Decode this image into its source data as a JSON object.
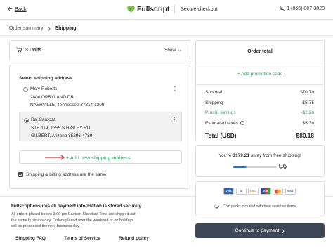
{
  "header": {
    "back_label": "Back",
    "brand_name": "Fullscript",
    "secure_label": "Secure checkout",
    "phone": "1 (866) 807-3828"
  },
  "breadcrumb": {
    "items": [
      "Order summary",
      "Shipping"
    ]
  },
  "units": {
    "label": "3 Units",
    "show_label": "Show"
  },
  "shipping": {
    "title": "Select shipping address",
    "addresses": [
      {
        "name": "Mary Roberts",
        "line1": "2804 OPRYLAND DR",
        "line2": "NASHVILLE, Tennessee 37214-1209",
        "selected": false
      },
      {
        "name": "Raj Cardosa",
        "line1": "STE 119, 1355 S HIGLEY RD",
        "line2": "GILBERT, Arizona 85296-4789",
        "selected": true
      }
    ],
    "add_new_label": "+ Add new shipping address",
    "billing_same_label": "Shipping & billing address are the same",
    "billing_same_checked": true
  },
  "info": {
    "heading": "Fullscript ensures all payment information is stored securely",
    "body_lines": [
      "All orders placed before 3:00 pm Eastern Standard Time are shipped out",
      "the same business day. Orders placed over the weekend or on holidays",
      "will be processed the next business day."
    ]
  },
  "footer_links": [
    "Shipping FAQ",
    "Terms of Service",
    "Refund policy"
  ],
  "order_total": {
    "title": "Order total",
    "promo_link": "+ Add promotion code",
    "subtotal_label": "Subtotal",
    "subtotal_value": "$70.79",
    "shipping_label": "Shipping",
    "shipping_value": "$5.75",
    "savings_label": "Promo savings",
    "savings_value": "-$2.26",
    "taxes_label": "Estimated taxes",
    "taxes_value": "$5.36",
    "total_label": "Total (USD)",
    "total_value": "$80.18"
  },
  "free_shipping": {
    "prefix": "You're ",
    "amount": "$179.21",
    "suffix": " away from free shipping!",
    "progress_percent": 30
  },
  "payment": {
    "card_icons": [
      "visa-card-icon",
      "amex-card-icon",
      "diners-card-icon",
      "discover-card-icon",
      "jcb-card-icon",
      "mastercard-card-icon",
      "visa-card-icon"
    ],
    "cold_packs_label": "Cold packs included with heat sensitive items"
  },
  "continue_label": "Continue to payment",
  "colors": {
    "accent_green": "#3c9a6a",
    "button_dark": "#3d4756",
    "progress_blue": "#3a6fa8",
    "arrow_red": "#d9333f"
  }
}
